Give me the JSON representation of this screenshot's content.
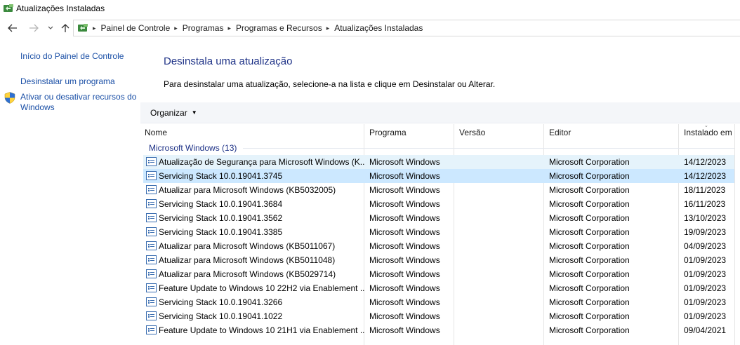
{
  "window": {
    "title": "Atualizações Instaladas",
    "icon": "control-panel-icon"
  },
  "navigation": {
    "back": "back-arrow-icon",
    "forward": "forward-arrow-icon",
    "recent": "chevron-down-icon",
    "up": "up-arrow-icon",
    "breadcrumb": [
      "Painel de Controle",
      "Programas",
      "Programas e Recursos",
      "Atualizações Instaladas"
    ]
  },
  "sidebar": {
    "links": [
      {
        "label": "Início do Painel de Controle"
      },
      {
        "label": "Desinstalar um programa"
      },
      {
        "label": "Ativar ou desativar recursos do Windows",
        "icon": "shield-icon"
      }
    ]
  },
  "main": {
    "heading": "Desinstala uma atualização",
    "instruction": "Para desinstalar uma atualização, selecione-a na lista e clique em Desinstalar ou Alterar.",
    "organize_label": "Organizar"
  },
  "table": {
    "columns": [
      "Nome",
      "Programa",
      "Versão",
      "Editor",
      "Instalado em"
    ],
    "group_label": "Microsoft Windows (13)",
    "rows": [
      {
        "name": "Atualização de Segurança para Microsoft Windows (K...",
        "program": "Microsoft Windows",
        "version": "",
        "publisher": "Microsoft Corporation",
        "installed": "14/12/2023"
      },
      {
        "name": "Servicing Stack 10.0.19041.3745",
        "program": "Microsoft Windows",
        "version": "",
        "publisher": "Microsoft Corporation",
        "installed": "14/12/2023"
      },
      {
        "name": "Atualizar para Microsoft Windows (KB5032005)",
        "program": "Microsoft Windows",
        "version": "",
        "publisher": "Microsoft Corporation",
        "installed": "18/11/2023"
      },
      {
        "name": "Servicing Stack 10.0.19041.3684",
        "program": "Microsoft Windows",
        "version": "",
        "publisher": "Microsoft Corporation",
        "installed": "16/11/2023"
      },
      {
        "name": "Servicing Stack 10.0.19041.3562",
        "program": "Microsoft Windows",
        "version": "",
        "publisher": "Microsoft Corporation",
        "installed": "13/10/2023"
      },
      {
        "name": "Servicing Stack 10.0.19041.3385",
        "program": "Microsoft Windows",
        "version": "",
        "publisher": "Microsoft Corporation",
        "installed": "19/09/2023"
      },
      {
        "name": "Atualizar para Microsoft Windows (KB5011067)",
        "program": "Microsoft Windows",
        "version": "",
        "publisher": "Microsoft Corporation",
        "installed": "04/09/2023"
      },
      {
        "name": "Atualizar para Microsoft Windows (KB5011048)",
        "program": "Microsoft Windows",
        "version": "",
        "publisher": "Microsoft Corporation",
        "installed": "01/09/2023"
      },
      {
        "name": "Atualizar para Microsoft Windows (KB5029714)",
        "program": "Microsoft Windows",
        "version": "",
        "publisher": "Microsoft Corporation",
        "installed": "01/09/2023"
      },
      {
        "name": "Feature Update to Windows 10 22H2 via Enablement ...",
        "program": "Microsoft Windows",
        "version": "",
        "publisher": "Microsoft Corporation",
        "installed": "01/09/2023"
      },
      {
        "name": "Servicing Stack 10.0.19041.3266",
        "program": "Microsoft Windows",
        "version": "",
        "publisher": "Microsoft Corporation",
        "installed": "01/09/2023"
      },
      {
        "name": "Servicing Stack 10.0.19041.1022",
        "program": "Microsoft Windows",
        "version": "",
        "publisher": "Microsoft Corporation",
        "installed": "01/09/2023"
      },
      {
        "name": "Feature Update to Windows 10 21H1 via Enablement ...",
        "program": "Microsoft Windows",
        "version": "",
        "publisher": "Microsoft Corporation",
        "installed": "09/04/2021"
      }
    ]
  },
  "colors": {
    "link": "#1a4fa6",
    "heading": "#1e3287",
    "hover_row": "#e5f3fb",
    "selected_row": "#cce8ff"
  }
}
